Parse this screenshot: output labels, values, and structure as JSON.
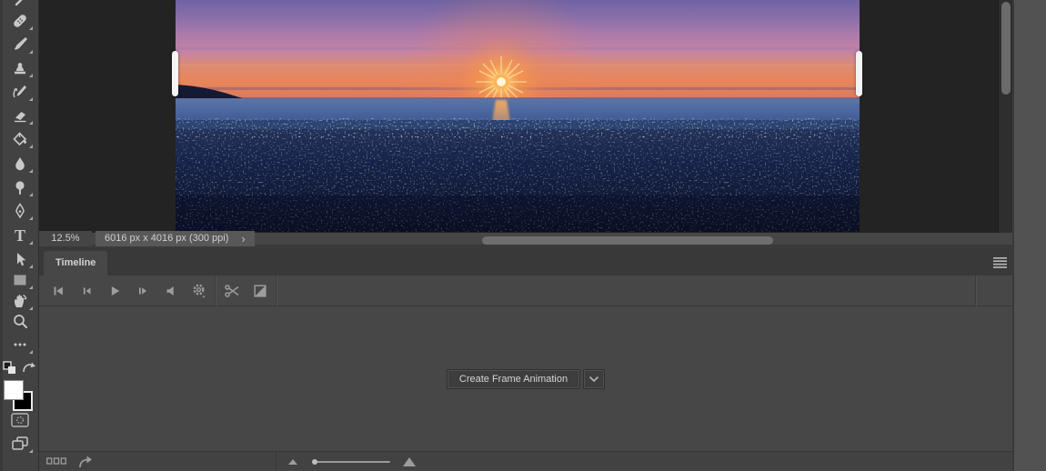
{
  "statusbar": {
    "zoom_level": "12.5%",
    "document_info": "6016 px x 4016 px (300 ppi)",
    "expand_chevron": "›"
  },
  "timeline": {
    "tab_label": "Timeline",
    "create_frame_animation_label": "Create Frame Animation",
    "playback_icons": [
      "first-frame-icon",
      "previous-frame-icon",
      "play-icon",
      "next-frame-icon",
      "audio-icon",
      "settings-gear-icon"
    ],
    "edit_icons": [
      "split-scissors-icon",
      "transition-icon"
    ],
    "footer_icons": [
      "convert-to-frame-animation-icon",
      "flatten-frames-arrow-icon",
      "zoom-out-mountain-icon",
      "zoom-slider",
      "zoom-in-mountain-icon"
    ],
    "panel_menu_icon": "hamburger-menu-icon"
  },
  "toolbar": {
    "tools": [
      "spot-healing-partial",
      "healing-brush",
      "brush",
      "clone-stamp",
      "history-brush",
      "eraser",
      "paint-bucket",
      "blur",
      "dodge",
      "pen",
      "type",
      "path-selection",
      "rectangle",
      "hand",
      "zoom",
      "edit-toolbar-ellipsis",
      "default-colors",
      "swap-colors",
      "foreground-background-swatches",
      "quick-mask",
      "screen-mode"
    ],
    "type_tool_glyph": "T"
  },
  "colors": {
    "canvas_bg": "#232323",
    "panel_bg": "#474747",
    "toolbar_bg": "#424242",
    "tab_bar_bg": "#393939",
    "right_dock_bg": "#525252",
    "icon_gray": "#9d9d9d",
    "toolbar_icon_gray": "#c8c8c8",
    "foreground_swatch": "#ffffff",
    "background_swatch": "#000000"
  },
  "photo": {
    "subject": "Sunset over a rocky lake shore",
    "sun": "#ffc04d",
    "sky_top": "#6f63a3",
    "sky_pink": "#c584a4",
    "sky_orange": "#e8855a",
    "water": "#4a659c",
    "rocks": "#101a38"
  }
}
